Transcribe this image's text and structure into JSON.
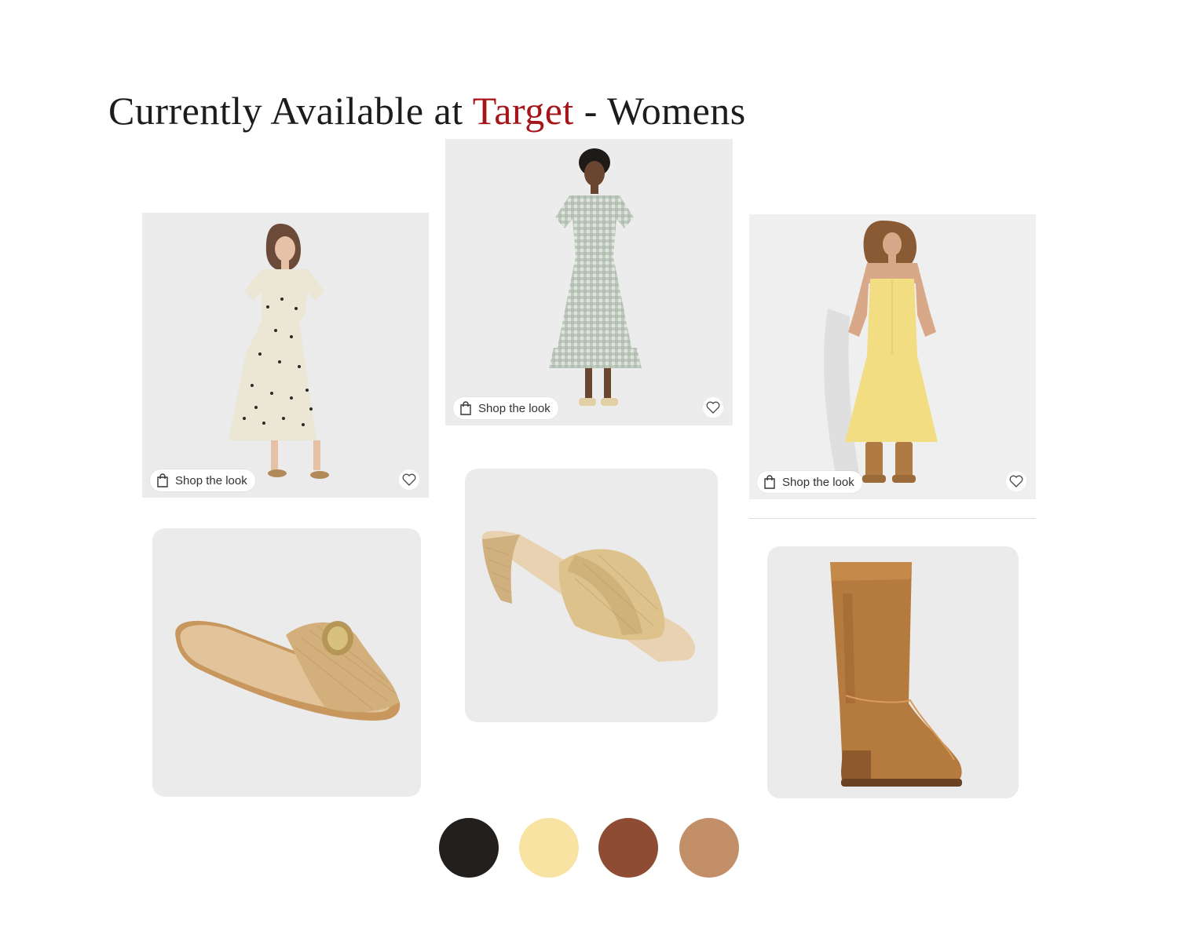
{
  "title": {
    "part1": "Currently Available at ",
    "brand": "Target",
    "part2": " - Womens"
  },
  "products": [
    {
      "label": "Shop the look"
    },
    {
      "label": "Shop the look"
    },
    {
      "label": "Shop the look"
    }
  ],
  "palette": {
    "colors": [
      "#221f1c",
      "#f8e3a3",
      "#8e4c35",
      "#c28f68"
    ]
  }
}
